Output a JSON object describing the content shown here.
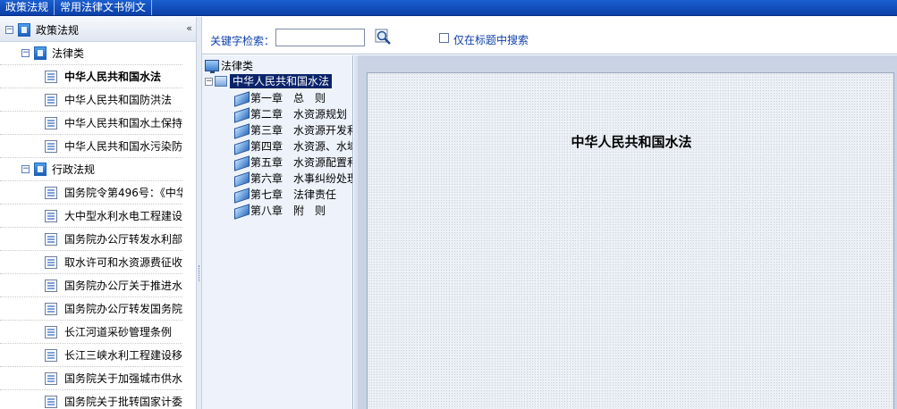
{
  "topbar": {
    "tabs": [
      "政策法规",
      "常用法律文书例文"
    ]
  },
  "sidebar": {
    "collapse_icon": "double-chevron-left-icon",
    "groups": [
      {
        "label": "政策法规",
        "children": []
      }
    ],
    "root_label": "政策法规",
    "category1": {
      "label": "法律类",
      "items": [
        "中华人民共和国水法",
        "中华人民共和国防洪法",
        "中华人民共和国水土保持",
        "中华人民共和国水污染防"
      ]
    },
    "category2": {
      "label": "行政法规",
      "items": [
        "国务院令第496号：《中华",
        "大中型水利水电工程建设",
        "国务院办公厅转发水利部",
        "取水许可和水资源费征收",
        "国务院办公厅关于推进水",
        "国务院办公厅转发国务院",
        "长江河道采砂管理条例",
        "长江三峡水利工程建设移",
        "国务院关于加强城市供水",
        "国务院关于批转国家计委"
      ]
    }
  },
  "search": {
    "keyword_label": "关键字检索：",
    "keyword_value": "",
    "title_only_label": "仅在标题中搜索",
    "title_only_checked": false
  },
  "tree": {
    "root_label": "法律类",
    "selected_label": "中华人民共和国水法",
    "chapters": [
      "第一章　总　则",
      "第二章　水资源规划",
      "第三章　水资源开发利",
      "第四章　水资源、水域",
      "第五章　水资源配置和",
      "第六章　水事纠纷处理",
      "第七章　法律责任",
      "第八章　附　则"
    ]
  },
  "content": {
    "title": "中华人民共和国水法"
  }
}
